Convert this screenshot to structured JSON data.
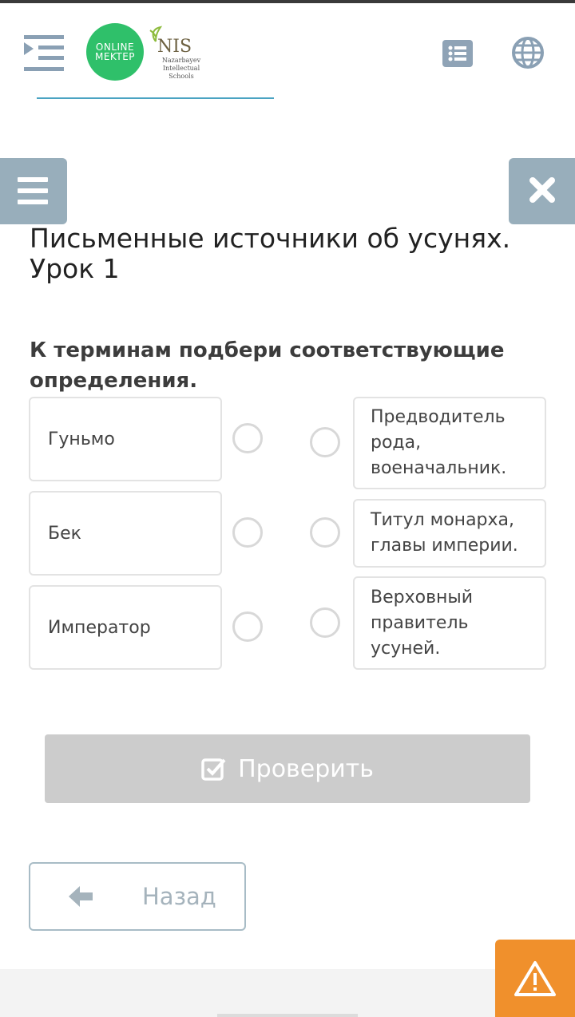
{
  "header": {
    "logo_line1": "ONLINE",
    "logo_line2": "MEKTEP",
    "nis_title": "NIS",
    "nis_subtitle": "Nazarbayev Intellectual Schools"
  },
  "lesson": {
    "title": "Письменные источники об усунях. Урок 1",
    "question": "К терминам подбери соответствующие определения."
  },
  "terms": [
    "Гуньмо",
    "Бек",
    "Император"
  ],
  "definitions": [
    "Предводитель рода, военачальник.",
    "Титул монарха, главы империи.",
    "Верховный правитель усуней."
  ],
  "actions": {
    "check_label": "Проверить",
    "back_label": "Назад"
  },
  "colors": {
    "accent_green": "#2fc06a",
    "side_button": "#98aebb",
    "check_disabled": "#cccccc",
    "warning": "#f0902c"
  }
}
